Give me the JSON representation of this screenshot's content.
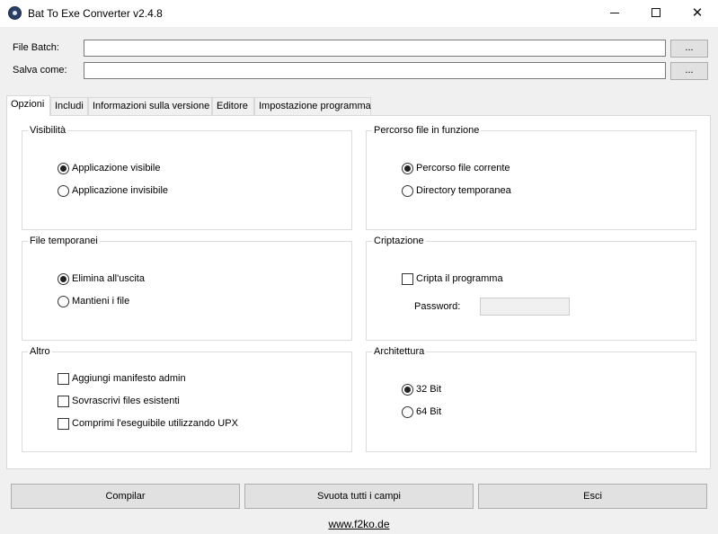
{
  "window": {
    "title": "Bat To Exe Converter v2.4.8",
    "icon": "app-icon"
  },
  "fields": {
    "batch_label": "File Batch:",
    "batch_value": "",
    "save_label": "Salva come:",
    "save_value": "",
    "browse_label": "..."
  },
  "tabs": [
    "Opzioni",
    "Includi",
    "Informazioni sulla versione",
    "Editore",
    "Impostazione programma"
  ],
  "options": {
    "visibility": {
      "title": "Visibilità",
      "items": [
        "Applicazione visibile",
        "Applicazione invisibile"
      ],
      "selected": 0
    },
    "path": {
      "title": "Percorso file in funzione",
      "items": [
        "Percorso file corrente",
        "Directory temporanea"
      ],
      "selected": 0
    },
    "temp": {
      "title": "File temporanei",
      "items": [
        "Elimina all'uscita",
        "Mantieni i file"
      ],
      "selected": 0
    },
    "crypt": {
      "title": "Criptazione",
      "checkbox": "Cripta il programma",
      "checked": false,
      "password_label": "Password:",
      "password_value": ""
    },
    "other": {
      "title": "Altro",
      "items": [
        "Aggiungi manifesto admin",
        "Sovrascrivi files esistenti",
        "Comprimi l'eseguibile utilizzando UPX"
      ]
    },
    "arch": {
      "title": "Architettura",
      "items": [
        "32 Bit",
        "64 Bit"
      ],
      "selected": 0
    }
  },
  "buttons": {
    "compile": "Compilar",
    "clear": "Svuota tutti i campi",
    "exit": "Esci"
  },
  "footer": {
    "link": "www.f2ko.de"
  }
}
